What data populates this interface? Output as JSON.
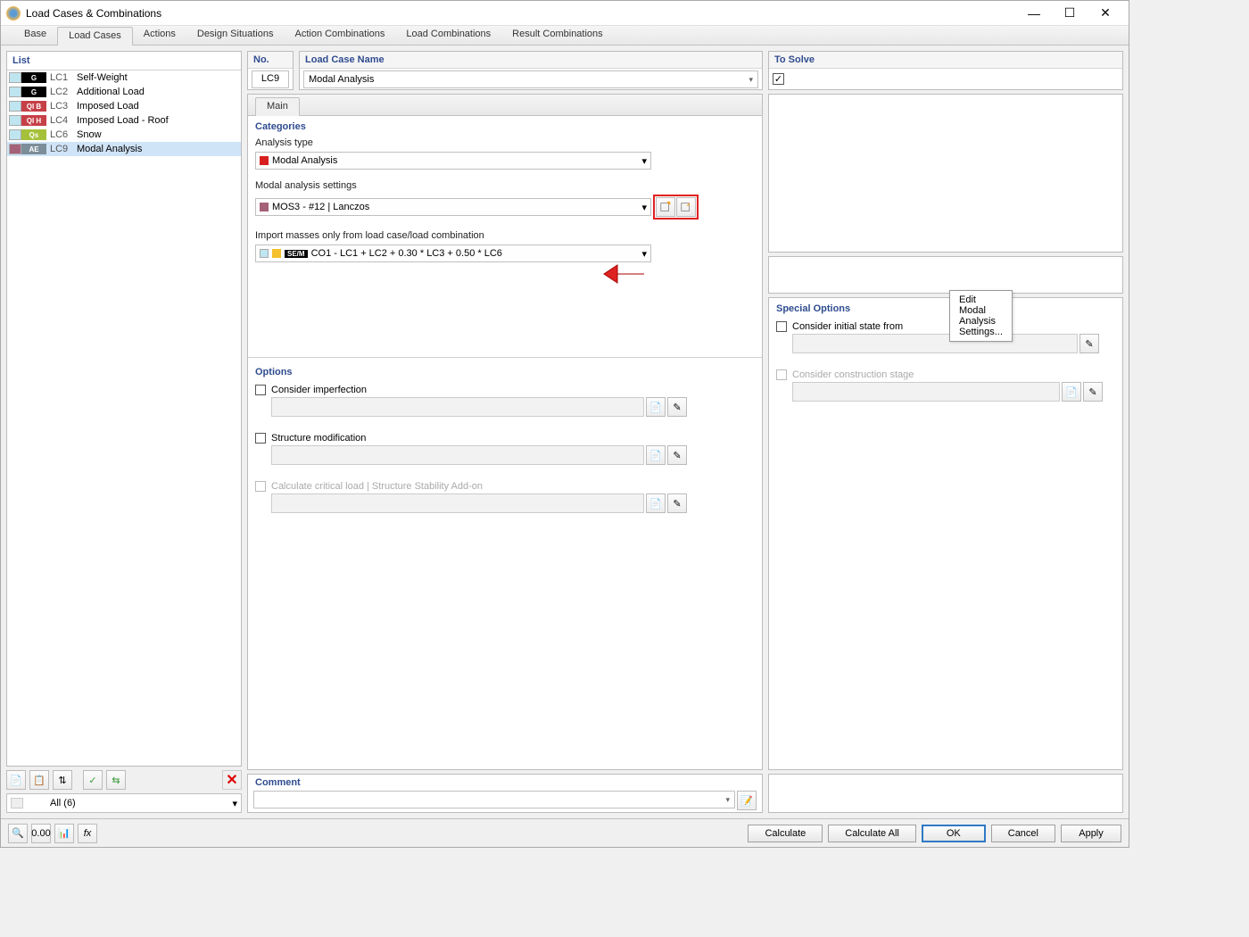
{
  "window": {
    "title": "Load Cases & Combinations"
  },
  "tabs": [
    "Base",
    "Load Cases",
    "Actions",
    "Design Situations",
    "Action Combinations",
    "Load Combinations",
    "Result Combinations"
  ],
  "activeTab": 1,
  "list": {
    "title": "List",
    "items": [
      {
        "swatch": "#bfe5f0",
        "cat": "G",
        "catbg": "#000000",
        "code": "LC1",
        "name": "Self-Weight"
      },
      {
        "swatch": "#bfe5f0",
        "cat": "G",
        "catbg": "#000000",
        "code": "LC2",
        "name": "Additional Load"
      },
      {
        "swatch": "#bfe5f0",
        "cat": "QI B",
        "catbg": "#c64048",
        "code": "LC3",
        "name": "Imposed Load"
      },
      {
        "swatch": "#bfe5f0",
        "cat": "QI H",
        "catbg": "#c64048",
        "code": "LC4",
        "name": "Imposed Load - Roof"
      },
      {
        "swatch": "#bfe5f0",
        "cat": "Qs",
        "catbg": "#a5c13a",
        "code": "LC6",
        "name": "Snow"
      },
      {
        "swatch": "#a5617a",
        "cat": "AE",
        "catbg": "#7c8e9a",
        "code": "LC9",
        "name": "Modal Analysis",
        "sel": true
      }
    ],
    "filter": "All (6)"
  },
  "header": {
    "no_label": "No.",
    "no_val": "LC9",
    "name_label": "Load Case Name",
    "name_val": "Modal Analysis",
    "solve_label": "To Solve"
  },
  "innerTabs": [
    "Main"
  ],
  "categories": {
    "title": "Categories",
    "analysis_label": "Analysis type",
    "analysis_val": "Modal Analysis",
    "analysis_sw": "#d81e1e",
    "modal_label": "Modal analysis settings",
    "modal_val": "MOS3 - #12 | Lanczos",
    "modal_sw": "#a5617a",
    "import_label": "Import masses only from load case/load combination",
    "import_val": "CO1 - LC1 + LC2 + 0.30 * LC3 + 0.50 * LC6",
    "import_badge": "SE/M",
    "import_sw": "#f5c12e"
  },
  "tooltip": "Edit Modal Analysis Settings...",
  "options": {
    "title": "Options",
    "o1": "Consider imperfection",
    "o2": "Structure modification",
    "o3": "Calculate critical load | Structure Stability Add-on"
  },
  "special": {
    "title": "Special Options",
    "s1": "Consider initial state from",
    "s2": "Consider construction stage"
  },
  "comment": {
    "title": "Comment"
  },
  "footer": {
    "calc": "Calculate",
    "calc_all": "Calculate All",
    "ok": "OK",
    "cancel": "Cancel",
    "apply": "Apply"
  }
}
